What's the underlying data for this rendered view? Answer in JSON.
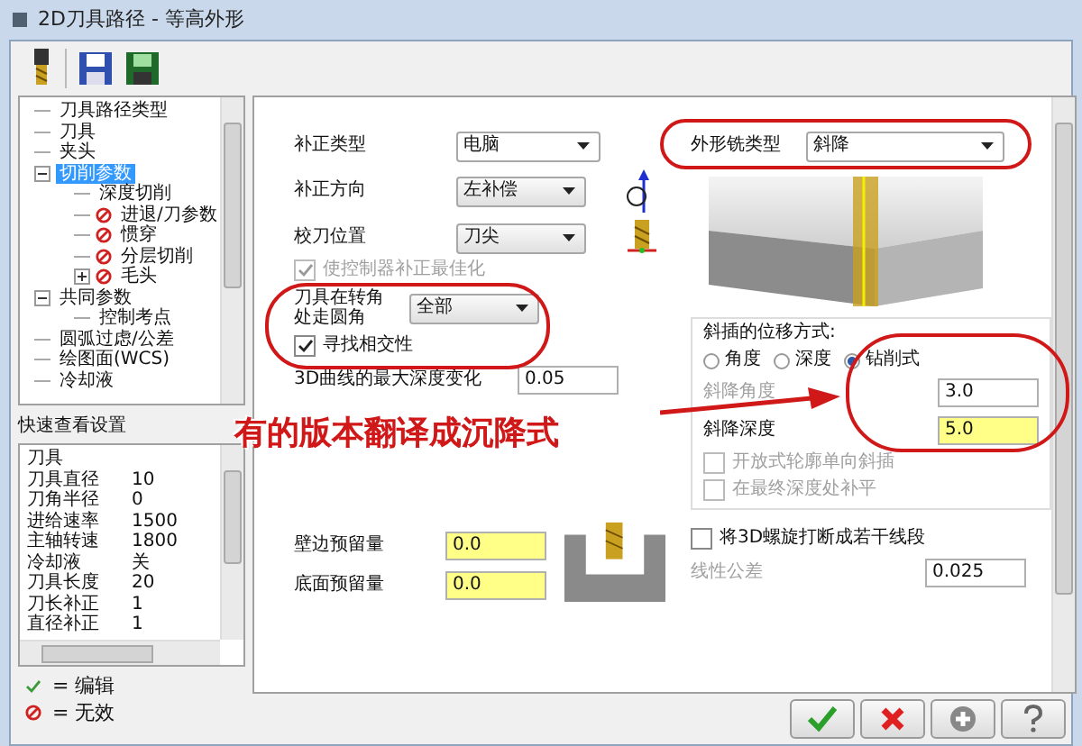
{
  "window": {
    "title": "2D刀具路径 - 等高外形"
  },
  "tree": [
    {
      "label": "刀具路径类型",
      "selected": false,
      "invalid": false
    },
    {
      "label": "刀具",
      "selected": false,
      "invalid": false
    },
    {
      "label": "夹头",
      "selected": false,
      "invalid": false
    },
    {
      "label": "切削参数",
      "selected": true,
      "invalid": false,
      "expanded": true,
      "children": [
        {
          "label": "深度切削",
          "selected": false,
          "invalid": false
        },
        {
          "label": "进退/刀参数",
          "selected": false,
          "invalid": true
        },
        {
          "label": "惯穿",
          "selected": false,
          "invalid": true
        },
        {
          "label": "分层切削",
          "selected": false,
          "invalid": true
        },
        {
          "label": "毛头",
          "selected": false,
          "invalid": true,
          "expanded": false
        }
      ]
    },
    {
      "label": "共同参数",
      "selected": false,
      "invalid": false,
      "expanded": true,
      "children": [
        {
          "label": "控制考点",
          "selected": false,
          "invalid": false
        }
      ]
    },
    {
      "label": "圆弧过虑/公差",
      "selected": false,
      "invalid": false
    },
    {
      "label": "绘图面(WCS)",
      "selected": false,
      "invalid": false
    },
    {
      "label": "冷却液",
      "selected": false,
      "invalid": false
    }
  ],
  "quick_view": {
    "title": "快速查看设置",
    "rows": [
      {
        "kind": "header",
        "label": "刀具"
      },
      {
        "kind": "row",
        "label": "刀具直径",
        "value": "10"
      },
      {
        "kind": "row",
        "label": "刀角半径",
        "value": "0"
      },
      {
        "kind": "row",
        "label": "进给速率",
        "value": "1500"
      },
      {
        "kind": "row",
        "label": "主轴转速",
        "value": "1800"
      },
      {
        "kind": "row",
        "label": "冷却液",
        "value": "关"
      },
      {
        "kind": "row",
        "label": "刀具长度",
        "value": "20"
      },
      {
        "kind": "row",
        "label": "刀长补正",
        "value": "1"
      },
      {
        "kind": "row",
        "label": "直径补正",
        "value": "1"
      }
    ]
  },
  "legend": [
    {
      "kind": "edit",
      "text": "= 编辑"
    },
    {
      "kind": "invalid",
      "text": "= 无效"
    }
  ],
  "compensation": {
    "type": {
      "label": "补正类型",
      "value": "电脑"
    },
    "direction": {
      "label": "补正方向",
      "value": "左补偿"
    },
    "tip": {
      "label": "校刀位置",
      "value": "刀尖"
    },
    "optimize": {
      "label": "使控制器补正最佳化",
      "checked": true,
      "disabled": true
    },
    "corner": {
      "label": "刀具在转角处走圆角",
      "value": "全部"
    },
    "intersect": {
      "label": "寻找相交性",
      "checked": true,
      "disabled": false
    },
    "depth_change": {
      "label": "3D曲线的最大深度变化",
      "value": "0.05"
    }
  },
  "stock": [
    {
      "label": "壁边预留量",
      "value": "0.0",
      "highlighted": true
    },
    {
      "label": "底面预留量",
      "value": "0.0",
      "highlighted": true
    }
  ],
  "contour_type": {
    "label": "外形铣类型",
    "value": "斜降"
  },
  "ramp": {
    "title": "斜插的位移方式:",
    "options": [
      {
        "label": "角度",
        "selected": false
      },
      {
        "label": "深度",
        "selected": false
      },
      {
        "label": "钻削式",
        "selected": true
      }
    ],
    "angle": {
      "label": "斜降角度",
      "value": "3.0",
      "disabled": true,
      "highlighted": false
    },
    "depth": {
      "label": "斜降深度",
      "value": "5.0",
      "disabled": false,
      "highlighted": true
    },
    "checks": [
      {
        "label": "开放式轮廓单向斜插",
        "checked": false,
        "disabled": true
      },
      {
        "label": "在最终深度处补平",
        "checked": false,
        "disabled": true
      }
    ]
  },
  "helix": {
    "label": "将3D螺旋打断成若干线段",
    "checked": false,
    "disabled": false
  },
  "tolerance": {
    "label": "线性公差",
    "value": "0.025",
    "disabled": true
  },
  "annotation": {
    "text": "有的版本翻译成沉降式"
  }
}
